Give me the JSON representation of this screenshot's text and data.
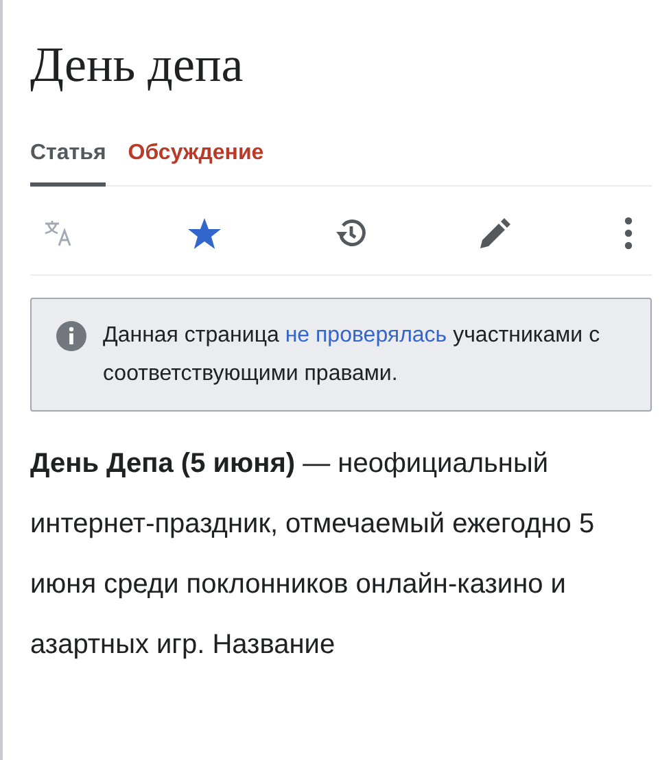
{
  "title": "День депа",
  "tabs": [
    {
      "label": "Статья",
      "selected": true
    },
    {
      "label": "Обсуждение",
      "selected": false
    }
  ],
  "notice": {
    "text_before": "Данная страница",
    "link": "не проверялась",
    "text_after": "участниками с соответствующими правами."
  },
  "paragraph": "**День Депа (5 июня)** — неофициальный интернет-праздник, отмечаемый ежегодно 5 июня среди поклонников онлайн-казино и азартных игр. Название"
}
